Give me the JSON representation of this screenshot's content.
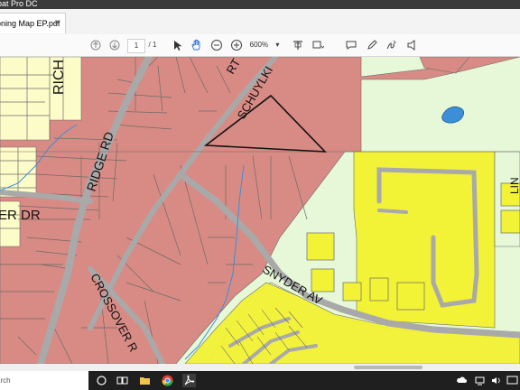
{
  "window": {
    "title": "obat Pro DC"
  },
  "tab": {
    "label": "oning Map EP.pdf",
    "close_glyph": "×"
  },
  "toolbar": {
    "icons": [
      "arrow-up-icon",
      "arrow-down-icon",
      "cursor-icon",
      "hand-icon",
      "zoom-out-icon",
      "zoom-in-icon",
      "zoom-dropdown-icon",
      "marquee-tool-icon",
      "scroll-mode-icon",
      "comment-icon",
      "pen-icon",
      "sign-icon",
      "share-icon"
    ],
    "page_current": "1",
    "page_total": "/ 1",
    "zoom_value": "600%",
    "zoom_caret": "▾"
  },
  "map": {
    "labels": {
      "richland": "RICH",
      "ridge_rd": "RIDGE RD",
      "rt": "RT",
      "schuylkill": "SCHUYLKI",
      "er_dr": "ER DR",
      "crossover": "CROSSOVER R",
      "snyder_av": "SNYDER AV",
      "lin": "LIN"
    },
    "colors": {
      "commercial": "#d88b84",
      "residential": "#fcfcc8",
      "high_density": "#f2f236",
      "open_space": "#e6f8d8",
      "road": "#a9a9a9",
      "water": "#3c8ed8",
      "lot_line": "#6b6b6b"
    }
  },
  "scrollbar": {
    "orientation": "horizontal"
  },
  "taskbar": {
    "search_text": "arch",
    "icons": [
      "cortana-circle-icon",
      "task-view-icon",
      "file-explorer-icon",
      "chrome-icon",
      "acrobat-icon",
      "cloud-icon",
      "network-icon",
      "volume-icon",
      "notification-icon"
    ]
  }
}
